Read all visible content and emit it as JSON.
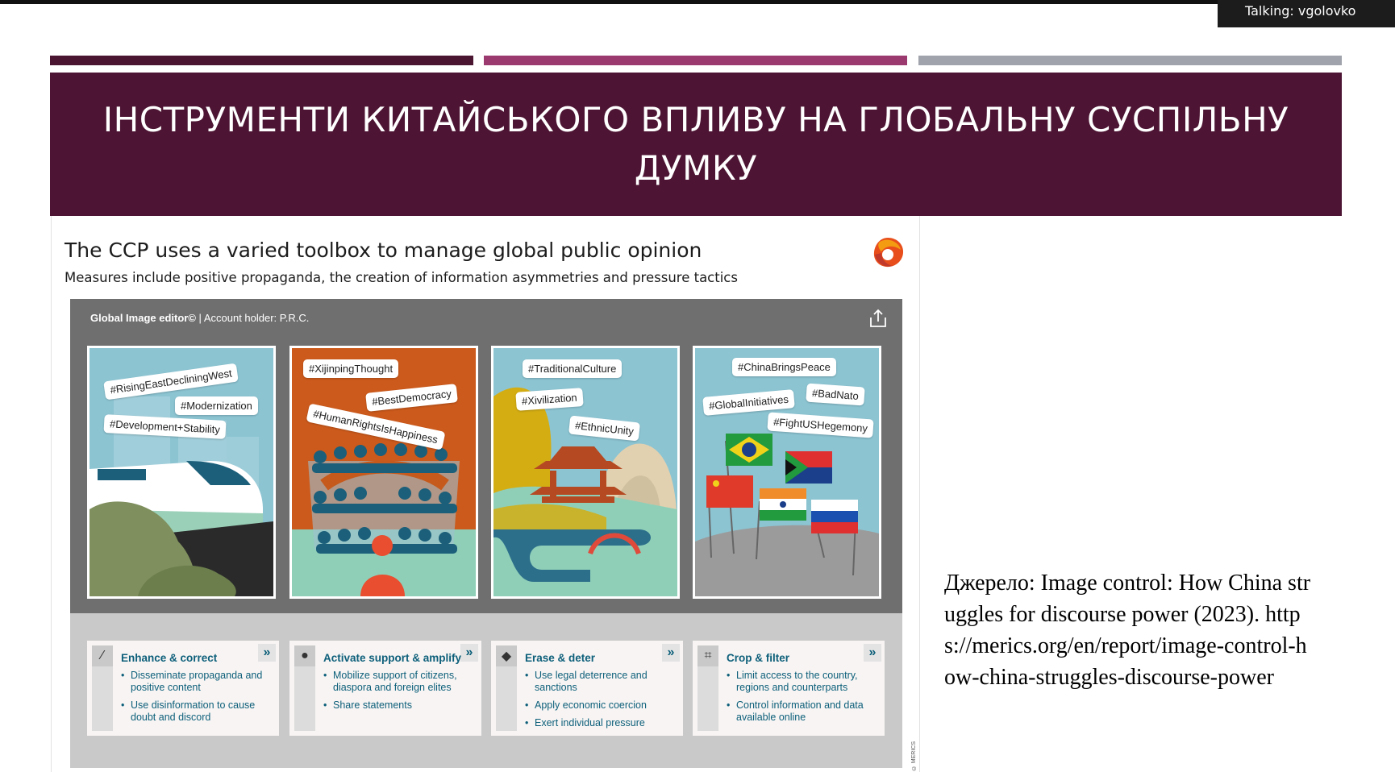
{
  "meeting": {
    "talking": "Talking: vgolovko"
  },
  "slide": {
    "title": "ІНСТРУМЕНТИ КИТАЙСЬКОГО ВПЛИВУ НА ГЛОБАЛЬНУ СУСПІЛЬНУ ДУМКУ",
    "source": "Джерело:  Image control: How China struggles for discourse power (2023). https://merics.org/en/report/image-control-how-china-struggles-discourse-power",
    "colors": {
      "accent": "#4d1533",
      "bar_mid": "#9a3a6e",
      "bar_grey": "#a0a3ab"
    }
  },
  "infographic": {
    "title": "The CCP uses a varied toolbox to manage global public opinion",
    "subtitle": "Measures include positive propaganda, the creation of information asymmetries and pressure tactics",
    "editor_name": "Global Image editor©",
    "editor_separator": " | ",
    "account": "Account holder: P.R.C.",
    "copyright": "© MERICS",
    "panels": [
      {
        "tags": [
          "#RisingEastDecliningWest",
          "#Modernization",
          "#Development+Stability"
        ]
      },
      {
        "tags": [
          "#XijinpingThought",
          "#BestDemocracy",
          "#HumanRightsIsHappiness"
        ]
      },
      {
        "tags": [
          "#TraditionalCulture",
          "#Xivilization",
          "#EthnicUnity"
        ]
      },
      {
        "tags": [
          "#ChinaBringsPeace",
          "#GlobalInitiatives",
          "#BadNato",
          "#FightUSHegemony"
        ]
      }
    ],
    "tools": [
      {
        "icon": "magic-wand-icon",
        "glyph": "⁄",
        "title": "Enhance & correct",
        "items": [
          "Disseminate propaganda and positive content",
          "Use disinformation to cause doubt and discord"
        ]
      },
      {
        "icon": "person-icon",
        "glyph": "●",
        "title": "Activate support & amplify",
        "items": [
          "Mobilize support of citizens, diaspora and foreign elites",
          "Share statements"
        ]
      },
      {
        "icon": "eraser-icon",
        "glyph": "◆",
        "title": "Erase & deter",
        "items": [
          "Use legal deterrence and sanctions",
          "Apply economic coercion",
          "Exert individual pressure"
        ]
      },
      {
        "icon": "crop-icon",
        "glyph": "⌗",
        "title": "Crop & filter",
        "items": [
          "Limit access to the country, regions and counterparts",
          "Control information and data available online"
        ]
      }
    ],
    "arrow_glyph": "»"
  }
}
